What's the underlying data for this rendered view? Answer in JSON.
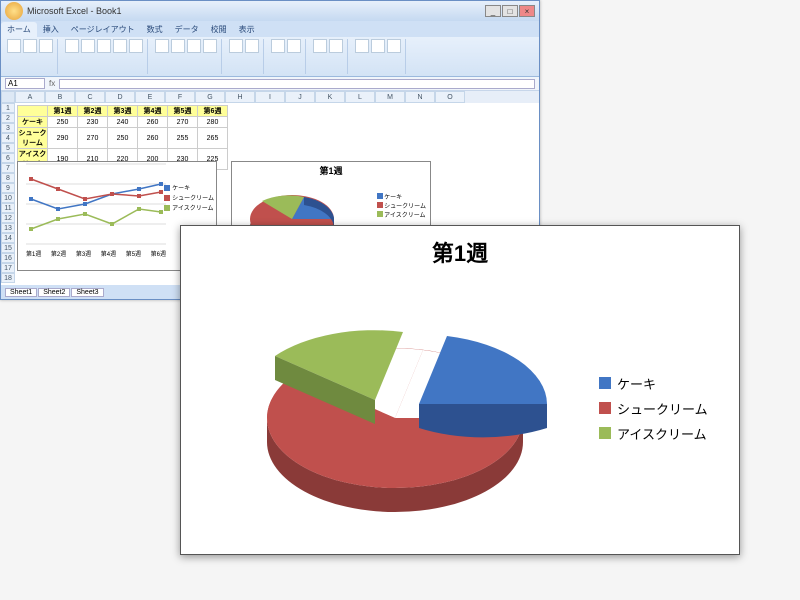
{
  "window": {
    "title": "Microsoft Excel - Book1"
  },
  "ribbon": {
    "tabs": [
      "ホーム",
      "挿入",
      "ページレイアウト",
      "数式",
      "データ",
      "校閲",
      "表示"
    ],
    "active_tab": "ホーム"
  },
  "formula_bar": {
    "name_box": "A1",
    "fx_label": "fx",
    "value": ""
  },
  "table": {
    "columns": [
      "第1週",
      "第2週",
      "第3週",
      "第4週",
      "第5週",
      "第6週"
    ],
    "rows": [
      {
        "label": "ケーキ",
        "values": [
          250,
          230,
          240,
          260,
          270,
          280
        ]
      },
      {
        "label": "シュークリーム",
        "values": [
          290,
          270,
          250,
          260,
          255,
          265
        ]
      },
      {
        "label": "アイスクリーム",
        "values": [
          190,
          210,
          220,
          200,
          230,
          225
        ]
      }
    ]
  },
  "line_chart": {
    "legend": [
      "ケーキ",
      "シュークリーム",
      "アイスクリーム"
    ],
    "colors": [
      "#4176c4",
      "#c0504d",
      "#9bbb59"
    ],
    "x_labels": [
      "第1週",
      "第2週",
      "第3週",
      "第4週",
      "第5週",
      "第6週"
    ]
  },
  "mini_pie": {
    "title": "第1週"
  },
  "big_chart": {
    "title": "第1週",
    "legend": [
      {
        "label": "ケーキ",
        "color": "#4176c4"
      },
      {
        "label": "シュークリーム",
        "color": "#c0504d"
      },
      {
        "label": "アイスクリーム",
        "color": "#9bbb59"
      }
    ]
  },
  "sheet_tabs": [
    "Sheet1",
    "Sheet2",
    "Sheet3"
  ],
  "chart_data": [
    {
      "type": "line",
      "title": "",
      "categories": [
        "第1週",
        "第2週",
        "第3週",
        "第4週",
        "第5週",
        "第6週"
      ],
      "series": [
        {
          "name": "ケーキ",
          "values": [
            250,
            230,
            240,
            260,
            270,
            280
          ]
        },
        {
          "name": "シュークリーム",
          "values": [
            290,
            270,
            250,
            260,
            255,
            265
          ]
        },
        {
          "name": "アイスクリーム",
          "values": [
            190,
            210,
            220,
            200,
            230,
            225
          ]
        }
      ],
      "xlabel": "",
      "ylabel": ""
    },
    {
      "type": "pie",
      "title": "第1週",
      "categories": [
        "ケーキ",
        "シュークリーム",
        "アイスクリーム"
      ],
      "values": [
        250,
        290,
        190
      ],
      "colors": [
        "#4176c4",
        "#c0504d",
        "#9bbb59"
      ]
    }
  ]
}
